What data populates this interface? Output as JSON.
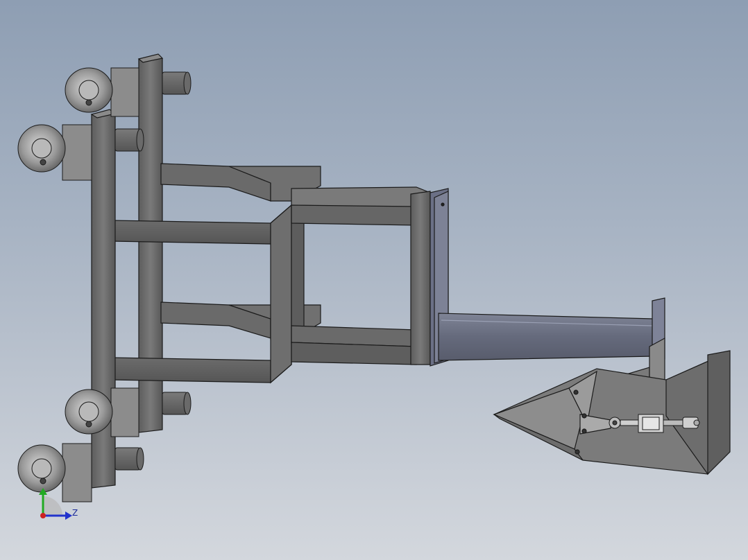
{
  "viewport": {
    "background_top": "#8e9eb3",
    "background_bottom": "#d3d7dd"
  },
  "model": {
    "type": "3D CAD assembly view",
    "components": [
      "frame",
      "casters",
      "boom-beam",
      "funnel-head",
      "cylinder"
    ]
  },
  "triad": {
    "z_label": "Z",
    "y_axis_color": "#22aa22",
    "z_axis_color": "#2233cc",
    "x_axis_color": "#cc2222"
  }
}
